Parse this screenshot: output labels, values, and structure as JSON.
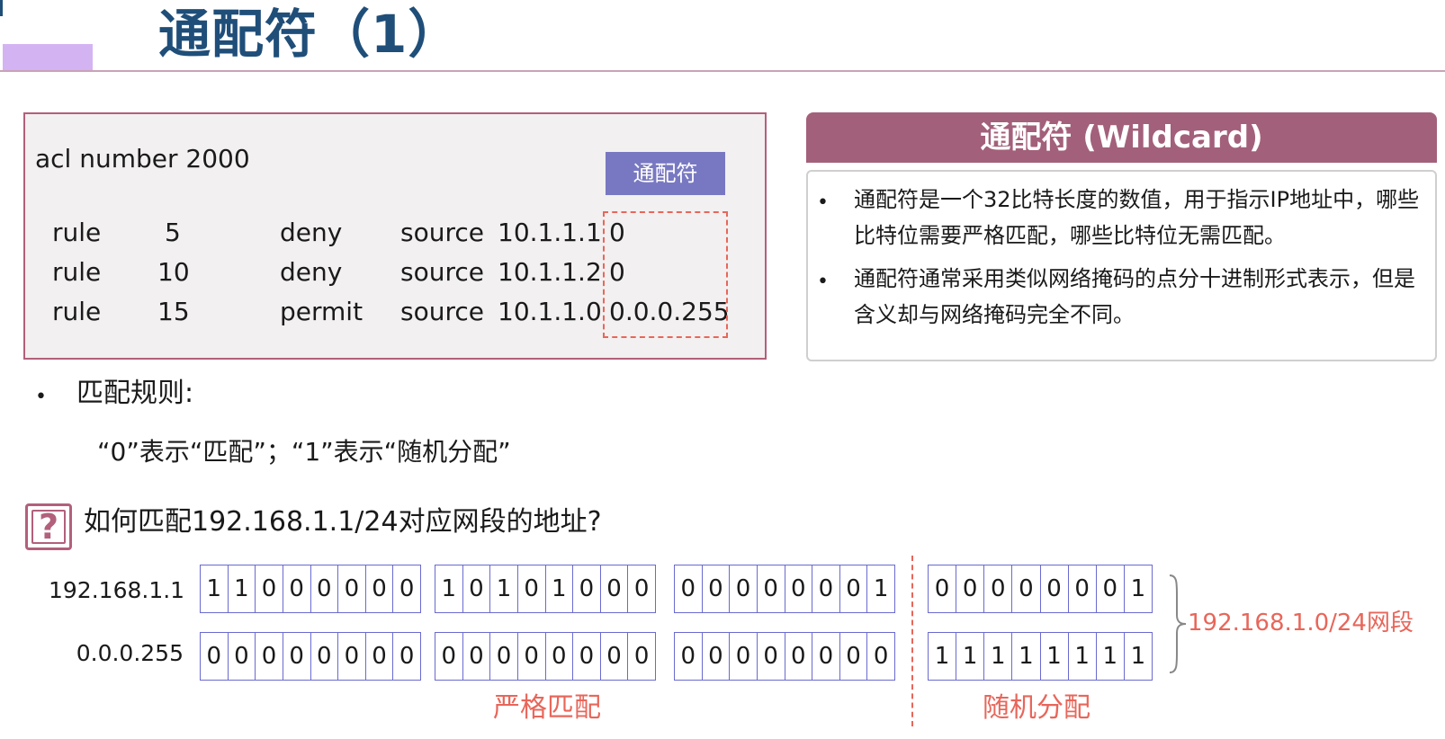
{
  "title": "通配符（1）",
  "acl": {
    "header": "acl number 2000",
    "tag": "通配符",
    "rules": [
      {
        "keyword": "rule",
        "id": "5",
        "action": "deny",
        "source": "source",
        "ip": "10.1.1.1",
        "wildcard": "0"
      },
      {
        "keyword": "rule",
        "id": "10",
        "action": "deny",
        "source": "source",
        "ip": "10.1.1.2",
        "wildcard": "0"
      },
      {
        "keyword": "rule",
        "id": "15",
        "action": "permit",
        "source": "source",
        "ip": "10.1.1.0",
        "wildcard": "0.0.0.255"
      }
    ]
  },
  "info": {
    "title": "通配符 (Wildcard)",
    "bullets": [
      "通配符是一个32比特长度的数值，用于指示IP地址中，哪些比特位需要严格匹配，哪些比特位无需匹配。",
      "通配符通常采用类似网络掩码的点分十进制形式表示，但是含义却与网络掩码完全不同。"
    ]
  },
  "match_rules": {
    "title": "匹配规则:",
    "text": "“0”表示“匹配”；“1”表示“随机分配”"
  },
  "question": {
    "icon": "question-mark-icon",
    "text": "如何匹配192.168.1.1/24对应网段的地址?"
  },
  "binary": {
    "rows": [
      {
        "label": "192.168.1.1",
        "octets": [
          "11000000",
          "10101000",
          "00000001",
          "00000001"
        ]
      },
      {
        "label": "0.0.0.255",
        "octets": [
          "00000000",
          "00000000",
          "00000000",
          "11111111"
        ]
      }
    ],
    "network_label": "192.168.1.0/24网段",
    "strict_label": "严格匹配",
    "random_label": "随机分配"
  },
  "colors": {
    "title": "#1f4e79",
    "accent": "#b2607b",
    "info_header": "#a3607a",
    "tag": "#7878c2",
    "highlight": "#e8665a",
    "bit_border": "#6a6ad0"
  }
}
